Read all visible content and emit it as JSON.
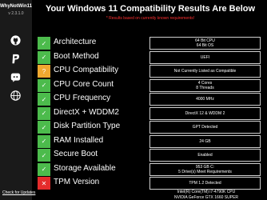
{
  "app": {
    "name": "WhyNotWin11",
    "version": "v 2.3.1.0"
  },
  "sidebar": {
    "icons": [
      {
        "name": "github-icon"
      },
      {
        "name": "paypal-icon"
      },
      {
        "name": "discord-icon"
      },
      {
        "name": "web-icon"
      }
    ],
    "check_updates": "Check for Updates"
  },
  "header": {
    "title": "Your Windows 11 Compatibility Results Are Below",
    "subtitle": "* Results based on currently known requirements!"
  },
  "colors": {
    "pass": "#4cbb4c",
    "warn": "#f0a830",
    "fail": "#e52b2b"
  },
  "checks": [
    {
      "status": "pass",
      "mark": "✓",
      "label": "Architecture",
      "value": [
        "64 Bit CPU",
        "64 Bit OS"
      ]
    },
    {
      "status": "pass",
      "mark": "✓",
      "label": "Boot Method",
      "value": [
        "UEFI"
      ]
    },
    {
      "status": "warn",
      "mark": "?",
      "label": "CPU Compatibility",
      "value": [
        "Not Currently Listed as Compatible"
      ]
    },
    {
      "status": "pass",
      "mark": "✓",
      "label": "CPU Core Count",
      "value": [
        "4 Cores",
        "8 Threads"
      ]
    },
    {
      "status": "pass",
      "mark": "✓",
      "label": "CPU Frequency",
      "value": [
        "4000 MHz"
      ]
    },
    {
      "status": "pass",
      "mark": "✓",
      "label": "DirectX + WDDM2",
      "value": [
        "DirectX 12 & WDDM 2"
      ]
    },
    {
      "status": "pass",
      "mark": "✓",
      "label": "Disk Partition Type",
      "value": [
        "GPT Detected"
      ]
    },
    {
      "status": "pass",
      "mark": "✓",
      "label": "RAM Installed",
      "value": [
        "24 GB"
      ]
    },
    {
      "status": "pass",
      "mark": "✓",
      "label": "Secure Boot",
      "value": [
        "Enabled"
      ]
    },
    {
      "status": "pass",
      "mark": "✓",
      "label": "Storage Available",
      "value": [
        "953 GB C:",
        "5 Drive(s) Meet Requirements"
      ]
    },
    {
      "status": "fail",
      "mark": "✕",
      "label": "TPM Version",
      "value": [
        "TPM 1.2 Detected"
      ]
    }
  ],
  "hardware": {
    "cpu": "Intel(R) Core(TM) i7-4790K CPU",
    "gpu": "NVIDIA GeForce GTX 1660 SUPER"
  }
}
